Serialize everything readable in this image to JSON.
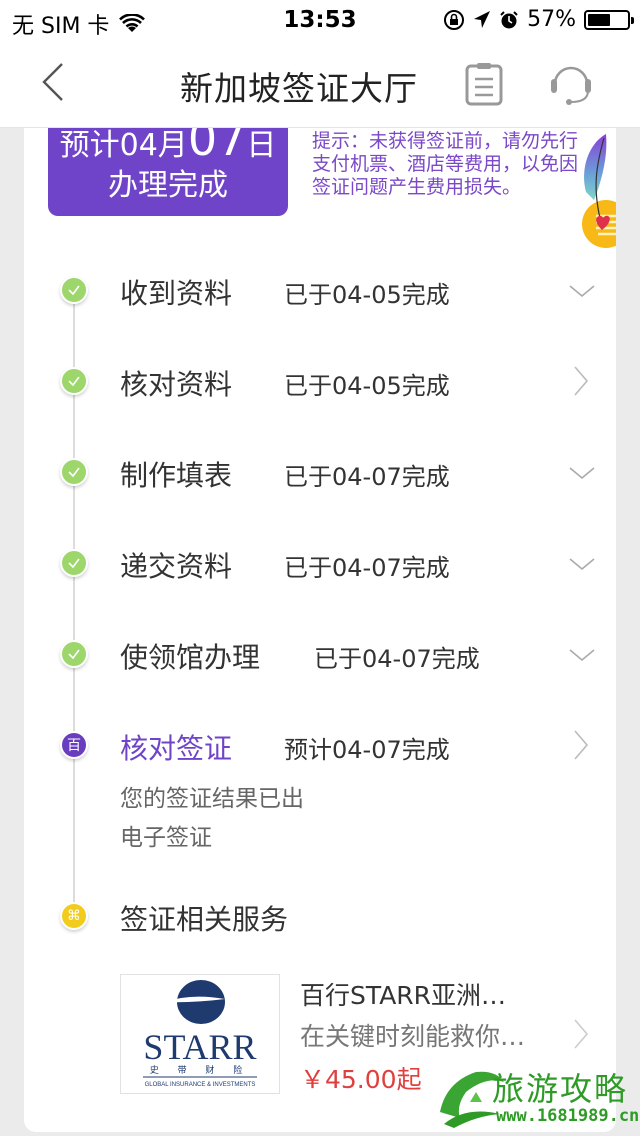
{
  "status_bar": {
    "carrier": "无 SIM 卡",
    "time": "13:53",
    "battery_percent_text": "57%",
    "battery_level": 0.57
  },
  "nav": {
    "title": "新加坡签证大厅",
    "back_icon": "chevron-left-icon",
    "order_icon": "clipboard-icon",
    "service_icon": "headset-icon"
  },
  "banner": {
    "line1_prefix": "预计04月",
    "line1_day": "07",
    "line1_suffix": "日",
    "line2": "办理完成"
  },
  "tip": "提示：未获得签证前，请勿先行支付机票、酒店等费用，以免因签证问题产生费用损失。",
  "steps": [
    {
      "name": "收到资料",
      "status": "已于04-05完成",
      "state": "done",
      "action": "expand"
    },
    {
      "name": "核对资料",
      "status": "已于04-05完成",
      "state": "done",
      "action": "navigate"
    },
    {
      "name": "制作填表",
      "status": "已于04-07完成",
      "state": "done",
      "action": "expand"
    },
    {
      "name": "递交资料",
      "status": "已于04-07完成",
      "state": "done",
      "action": "expand"
    },
    {
      "name": "使领馆办理",
      "status": "已于04-07完成",
      "state": "done",
      "action": "expand"
    },
    {
      "name": "核对签证",
      "status": "预计04-07完成",
      "state": "current",
      "action": "navigate",
      "badge": "百",
      "details": [
        "您的签证结果已出",
        "电子签证"
      ]
    },
    {
      "name": "签证相关服务",
      "state": "service",
      "badge": "⌘"
    }
  ],
  "product": {
    "logo_text": "STARR",
    "logo_cn": "史 带 财 险",
    "logo_tagline": "GLOBAL INSURANCE & INVESTMENTS",
    "title": "百行STARR亚洲…",
    "description": "在关键时刻能救你…",
    "price": "￥45.00起"
  },
  "watermark": {
    "text": "旅游攻略",
    "url": "www.1681989.cn"
  },
  "colors": {
    "accent": "#7044c8",
    "done": "#9dd66a",
    "service": "#f2cc1d",
    "price": "#e0403d"
  }
}
